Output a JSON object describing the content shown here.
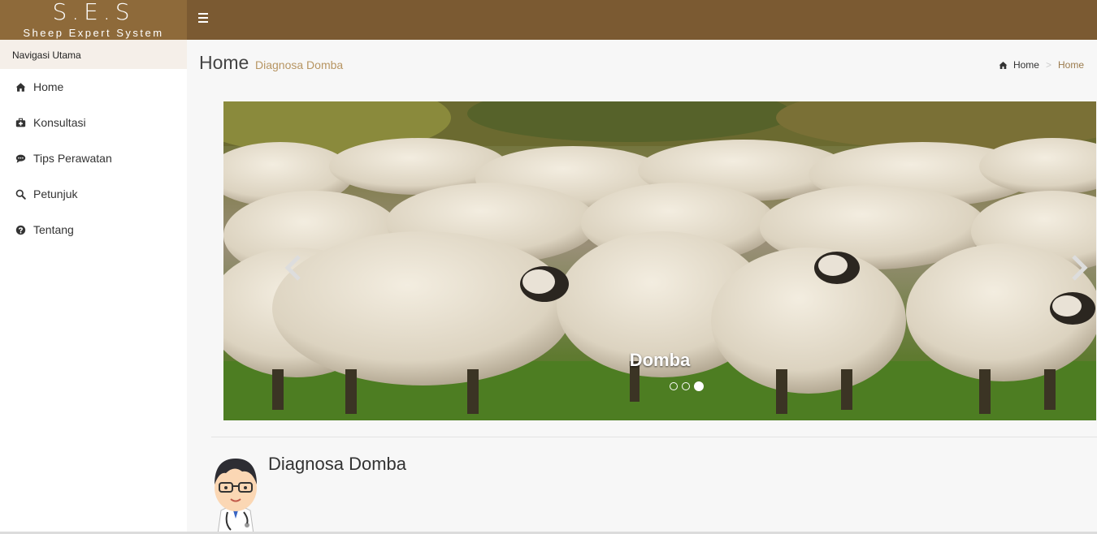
{
  "header": {
    "logo_main": "S.E.S",
    "logo_sub": "Sheep Expert System"
  },
  "sidebar": {
    "header": "Navigasi Utama",
    "items": [
      {
        "label": "Home",
        "icon": "home-icon"
      },
      {
        "label": "Konsultasi",
        "icon": "medkit-icon"
      },
      {
        "label": "Tips Perawatan",
        "icon": "comments-icon"
      },
      {
        "label": "Petunjuk",
        "icon": "search-icon"
      },
      {
        "label": "Tentang",
        "icon": "question-circle-icon"
      }
    ]
  },
  "page": {
    "title": "Home",
    "subtitle": "Diagnosa Domba"
  },
  "breadcrumb": {
    "home": "Home",
    "active": "Home"
  },
  "carousel": {
    "caption": "Domba",
    "slide_count": 3,
    "active_index": 2
  },
  "section": {
    "title": "Diagnosa Domba"
  },
  "colors": {
    "logo_bg": "#8e6a3a",
    "topbar_bg": "#7b5a32",
    "accent_text": "#b79562"
  }
}
